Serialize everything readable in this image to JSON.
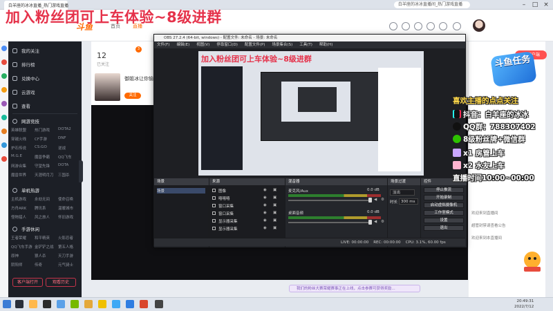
{
  "browser": {
    "tab_label": "白羊座的冰冰直播_热门游戏直播",
    "omnibox_text": "白羊座的冰冰直播间_热门游戏直播"
  },
  "overlay": {
    "title": "加入粉丝团可上车体验~8级进群"
  },
  "topnav": {
    "logo": "斗鱼",
    "links": [
      "首页",
      "直播"
    ]
  },
  "sidebar": {
    "items": [
      "我的关注",
      "排行榜",
      "兑换中心",
      "云游戏"
    ],
    "more_label": "查看",
    "sections": [
      {
        "title": "网游竞技",
        "games": [
          "英雄联盟",
          "热门游戏",
          "DOTA2",
          "穿越火线",
          "CF手游",
          "DNF",
          "炉石传说",
          "CS:GO",
          "逆战",
          "M.G.E",
          "魔兽争霸",
          "QQ飞车",
          "网游合集",
          "守望先锋",
          "DOTA",
          "魔兽世界",
          "天涯明月刀",
          "三国杀"
        ]
      },
      {
        "title": "单机热游",
        "games": [
          "主机游戏",
          "永劫无间",
          "使命召唤",
          "方舟ARK",
          "腾讯系",
          "温暖城市",
          "怪物猎人",
          "风之旅人",
          "怀旧游戏"
        ]
      },
      {
        "title": "手游休闲",
        "games": [
          "王者荣耀",
          "和平精英",
          "火影忍者",
          "QQ飞车手游",
          "金铲铲之战",
          "第五人格",
          "原神",
          "狼人杀",
          "天刀手游",
          "阴阳师",
          "传奇",
          "元气骑士"
        ]
      }
    ],
    "button_client": "客户端打开",
    "button_history": "观看历史"
  },
  "infocard": {
    "stat_value": "12",
    "stat_label": "已关注",
    "badge": "3",
    "streamer_name": "御姐冰让你愉快",
    "follow_label": "关注"
  },
  "obs": {
    "title": "OBS 27.2.4 (64-bit, windows) - 配置文件: 未命名 - 场景: 未命名",
    "menu": [
      "文件(F)",
      "编辑(E)",
      "视图(V)",
      "停靠窗口(D)",
      "配置文件(P)",
      "场景集合(S)",
      "工具(T)",
      "帮助(H)"
    ],
    "docks": {
      "scenes": {
        "title": "场景",
        "items": [
          "场景"
        ]
      },
      "sources": {
        "title": "来源",
        "tabs": [
          "属性",
          "滤镜"
        ],
        "items": [
          "图像",
          "嘻嘻嘻",
          "窗口采集",
          "窗口采集",
          "显示器采集",
          "显示器采集"
        ]
      },
      "mixer": {
        "title": "混音器",
        "channels": [
          {
            "label": "麦克风/Aux",
            "db": "0.0 dB"
          },
          {
            "label": "桌面音频",
            "db": "0.0 dB"
          }
        ]
      },
      "transitions": {
        "title": "场景过渡",
        "type": "淡出",
        "duration_label": "时长",
        "duration": "300 ms"
      },
      "controls": {
        "title": "控件",
        "buttons": [
          "停止推流",
          "开始录制",
          "启动虚拟摄像机",
          "工作室模式",
          "设置",
          "退出"
        ]
      }
    },
    "status": {
      "live": "LIVE: 00:00:00",
      "rec": "REC: 00:00:00",
      "cpu": "CPU: 3.1%, 60.00 fps"
    }
  },
  "stream_overlay": {
    "heading": "喜欢主播的点点关注",
    "douyin": "抖音：白羊座的冰冰",
    "qq": "QQ群：788307402",
    "wechat": "8级粉丝牌+微信群",
    "car1": "x1 房管上车",
    "car2": "x2 水友上车",
    "schedule": "直播时间10:00~00:00",
    "badge_text": "斗鱼任务",
    "pc_button": "PC客户端"
  },
  "chat": {
    "lines": [
      "欢迎来到直播间",
      "超管封禁请查看公告",
      "欢迎来到本直播间"
    ]
  },
  "notice": "我们的粉丝大赛荣耀赛事正在上线，点击参赛可获得奖励...",
  "taskbar": {
    "time": "20:49:31",
    "date": "2022/7/12"
  },
  "colors": {
    "accent": "#ff6a00",
    "overlay_red": "#e5324a",
    "sidebar_bg": "#1c1f26",
    "obs_bg": "#2c2e33"
  }
}
